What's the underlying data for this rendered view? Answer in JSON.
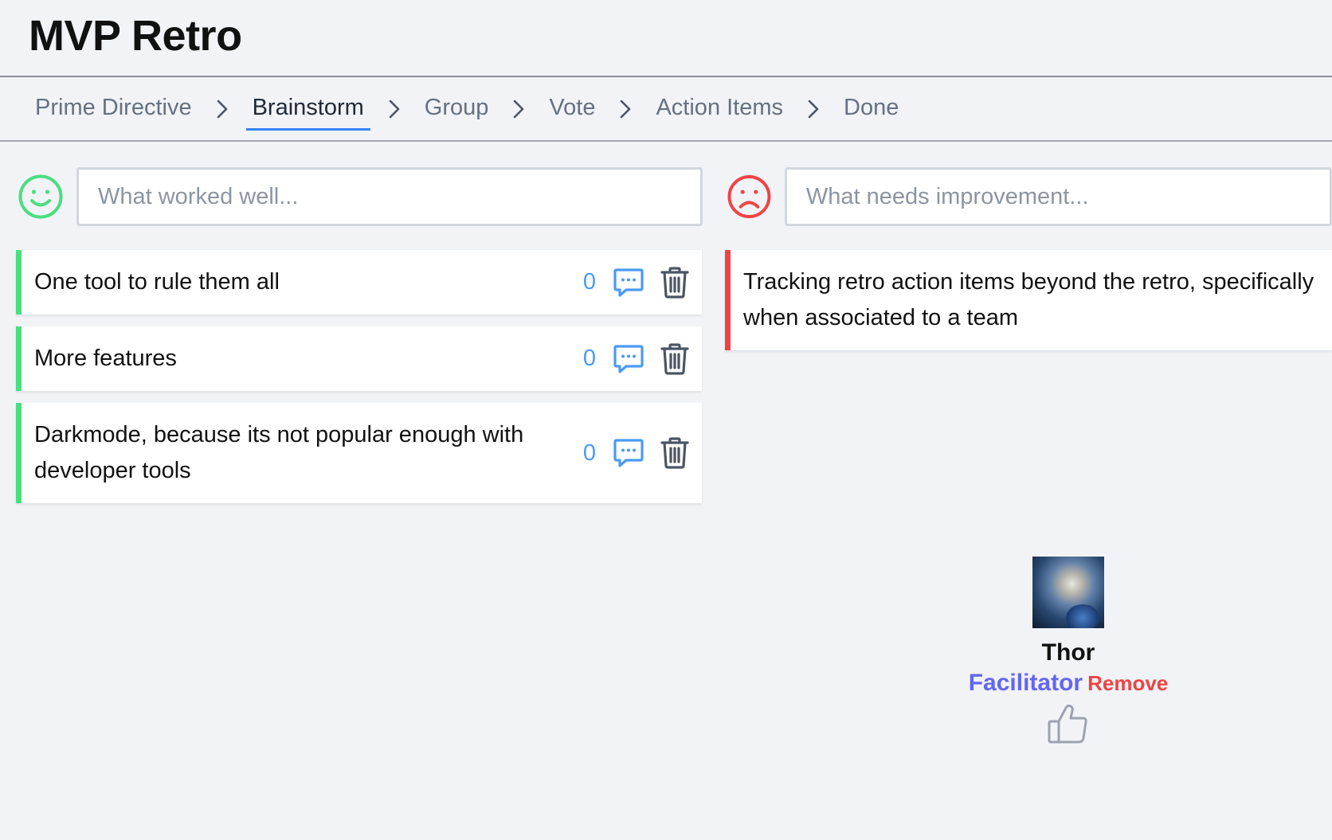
{
  "page": {
    "title": "MVP Retro"
  },
  "steps": [
    {
      "label": "Prime Directive"
    },
    {
      "label": "Brainstorm",
      "active": true
    },
    {
      "label": "Group"
    },
    {
      "label": "Vote"
    },
    {
      "label": "Action Items"
    },
    {
      "label": "Done"
    }
  ],
  "columns": {
    "positive": {
      "placeholder": "What worked well...",
      "icon": "smile-face-icon",
      "color": "#4ade80",
      "cards": [
        {
          "text": "One tool to rule them all",
          "votes": "0"
        },
        {
          "text": "More features",
          "votes": "0"
        },
        {
          "text": "Darkmode, because its not popular enough with developer tools",
          "votes": "0"
        }
      ]
    },
    "negative": {
      "placeholder": "What needs improvement...",
      "icon": "frown-face-icon",
      "color": "#ef4444",
      "cards": [
        {
          "text": "Tracking retro action items beyond the retro, specifically when associated to a team"
        }
      ]
    }
  },
  "participant": {
    "name": "Thor",
    "role": "Facilitator",
    "remove_label": "Remove"
  },
  "colors": {
    "accent": "#3b82f6",
    "positive": "#4ade80",
    "negative": "#ef4444",
    "facilitator": "#6366f1"
  }
}
